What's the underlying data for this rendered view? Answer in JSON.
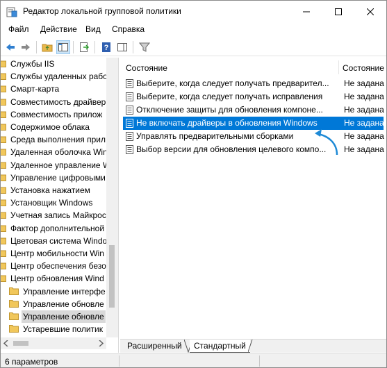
{
  "window": {
    "title": "Редактор локальной групповой политики"
  },
  "menu": [
    {
      "label": "Файл"
    },
    {
      "label": "Действие"
    },
    {
      "label": "Вид"
    },
    {
      "label": "Справка"
    }
  ],
  "tree": {
    "items": [
      {
        "label": "Службы IIS",
        "indent": 0
      },
      {
        "label": "Службы удаленных рабо",
        "indent": 0
      },
      {
        "label": "Смарт-карта",
        "indent": 0
      },
      {
        "label": "Совместимость драйвер",
        "indent": 0
      },
      {
        "label": "Совместимость прилож",
        "indent": 0
      },
      {
        "label": "Содержимое облака",
        "indent": 0
      },
      {
        "label": "Среда выполнения прил",
        "indent": 0
      },
      {
        "label": "Удаленная оболочка Win",
        "indent": 0
      },
      {
        "label": "Удаленное управление W",
        "indent": 0
      },
      {
        "label": "Управление цифровыми",
        "indent": 0
      },
      {
        "label": "Установка нажатием",
        "indent": 0
      },
      {
        "label": "Установщик Windows",
        "indent": 0
      },
      {
        "label": "Учетная запись Майкрос",
        "indent": 0
      },
      {
        "label": "Фактор дополнительной",
        "indent": 0
      },
      {
        "label": "Цветовая система Windo",
        "indent": 0
      },
      {
        "label": "Центр мобильности Win",
        "indent": 0
      },
      {
        "label": "Центр обеспечения безо",
        "indent": 0
      },
      {
        "label": "Центр обновления Wind",
        "indent": 0
      },
      {
        "label": "Управление интерфе",
        "indent": 1
      },
      {
        "label": "Управление обновле",
        "indent": 1
      },
      {
        "label": "Управление обновле",
        "indent": 1,
        "selected": true
      },
      {
        "label": "Устаревшие политик",
        "indent": 1
      }
    ]
  },
  "list": {
    "columns": {
      "name": "Состояние",
      "state": "Состояние"
    },
    "rows": [
      {
        "name": "Выберите, когда следует получать предварител...",
        "state": "Не задана"
      },
      {
        "name": "Выберите, когда следует получать исправления",
        "state": "Не задана"
      },
      {
        "name": "Отключение защиты для обновления компоне...",
        "state": "Не задана"
      },
      {
        "name": "Не включать драйверы в обновления Windows",
        "state": "Не задана",
        "selected": true
      },
      {
        "name": "Управлять предварительными сборками",
        "state": "Не задана"
      },
      {
        "name": "Выбор версии для обновления целевого компо...",
        "state": "Не задана"
      }
    ]
  },
  "tabs": [
    {
      "label": "Расширенный"
    },
    {
      "label": "Стандартный",
      "active": true
    }
  ],
  "status": {
    "text": "6 параметров"
  },
  "colors": {
    "selection": "#0078d7",
    "annotation_arrow": "#1e8ad6",
    "folder": "#e8b84a"
  }
}
